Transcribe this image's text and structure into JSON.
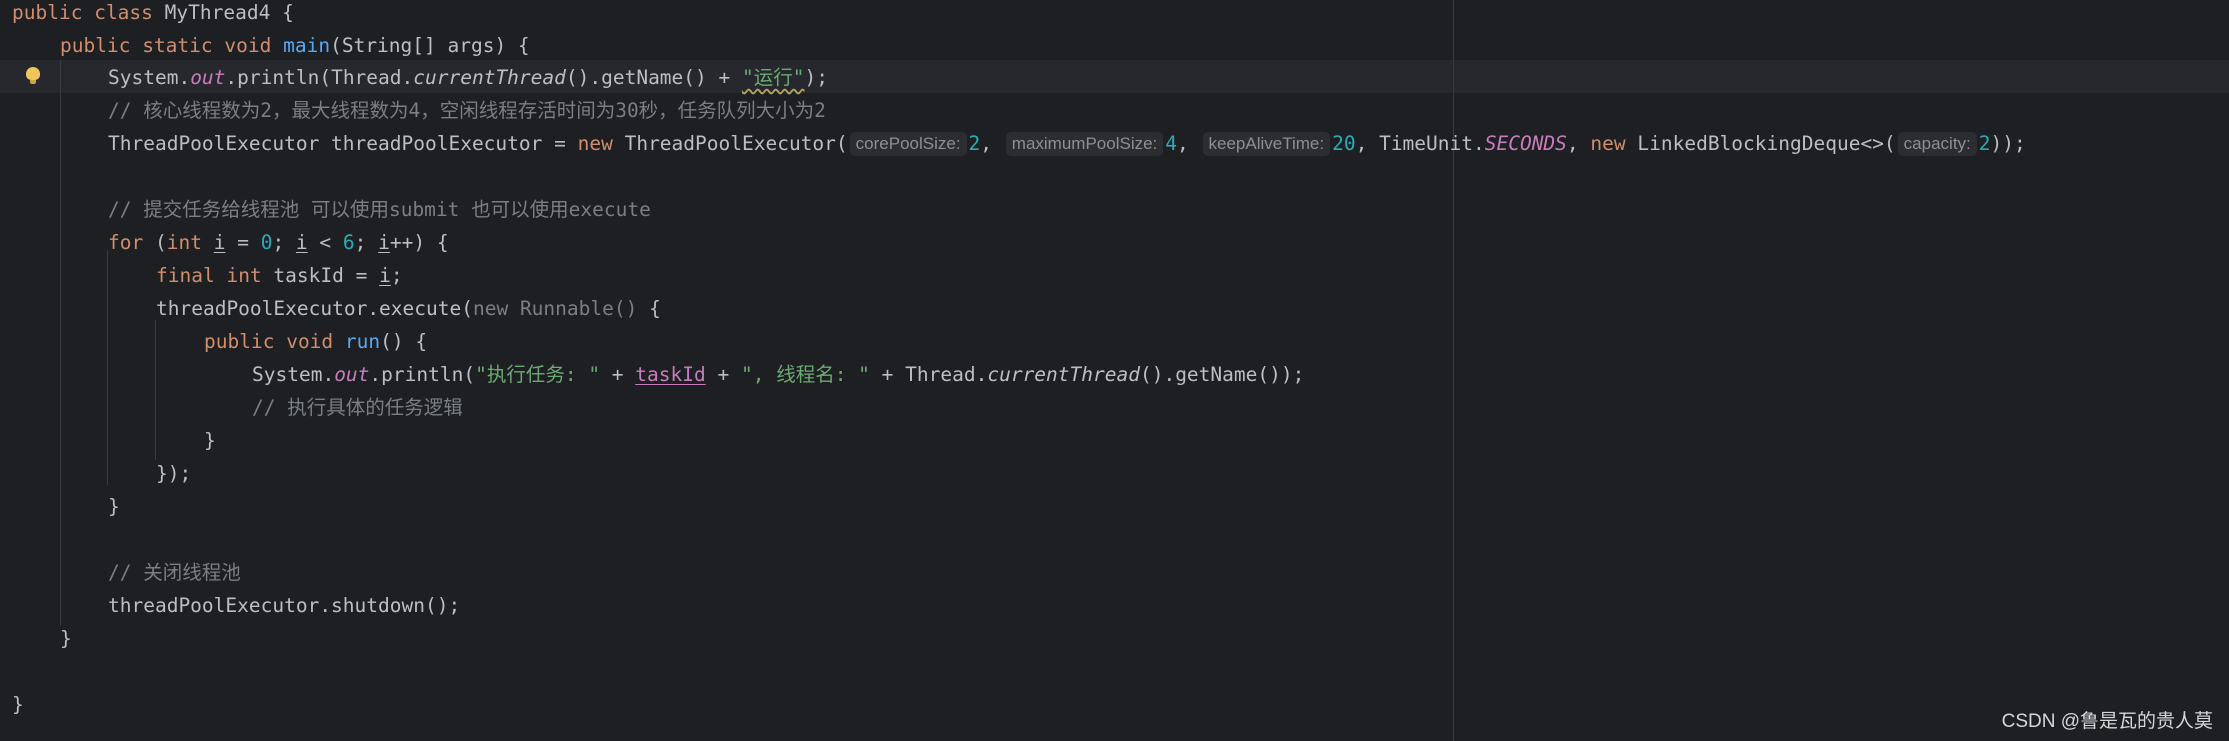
{
  "class_header": {
    "kw_public": "public",
    "kw_class": "class",
    "class_name": "MyThread4",
    "brace": " {"
  },
  "main_header": {
    "kw_public": "public",
    "kw_static": "static",
    "kw_void": "void",
    "method_name": "main",
    "params": "(String[] args) {"
  },
  "line_print_main": {
    "system": "System.",
    "out": "out",
    "println_open": ".println(Thread.",
    "current_thread": "currentThread",
    "get_name": "().getName() + ",
    "string_literal": "\"运行\"",
    "close": ");"
  },
  "comment_pool_config": "// 核心线程数为2，最大线程数为4，空闲线程存活时间为30秒，任务队列大小为2",
  "line_executor_decl": {
    "declaration": "ThreadPoolExecutor threadPoolExecutor = ",
    "kw_new": "new",
    "constructor_open": " ThreadPoolExecutor(",
    "hint_core": "corePoolSize:",
    "val_core": "2",
    "sep1": ", ",
    "hint_max": "maximumPoolSize:",
    "val_max": "4",
    "sep2": ", ",
    "hint_keep_alive": "keepAliveTime:",
    "val_keep_alive": "20",
    "time_unit": ", TimeUnit.",
    "seconds": "SECONDS",
    "sep3": ", ",
    "kw_new2": "new",
    "deque_open": " LinkedBlockingDeque<>(",
    "hint_capacity": "capacity:",
    "val_capacity": "2",
    "close": "));"
  },
  "comment_submit": "// 提交任务给线程池 可以使用submit 也可以使用execute",
  "line_for": {
    "kw_for": "for",
    "open": " (",
    "kw_int": "int",
    "var1": "i",
    "assign": " = ",
    "zero": "0",
    "semi1": "; ",
    "var2": "i",
    "less": " < ",
    "six": "6",
    "semi2": "; ",
    "var3": "i",
    "tail": "++) {"
  },
  "line_task_id": {
    "kw_final": "final",
    "kw_int": "int",
    "mid": " taskId = ",
    "var_i": "i",
    "semi": ";"
  },
  "line_execute": {
    "call": "threadPoolExecutor.execute(",
    "anon": "new Runnable()",
    "brace": " {"
  },
  "line_run": {
    "kw_public": "public",
    "kw_void": "void",
    "method_name": "run",
    "tail": "() {"
  },
  "line_print_task": {
    "system": "System.",
    "out": "out",
    "println_open": ".println(",
    "str1": "\"执行任务: \"",
    "plus1": " + ",
    "task_id": "taskId",
    "plus2": " + ",
    "str2": "\", 线程名: \"",
    "plus3": " + Thread.",
    "current_thread": "currentThread",
    "tail": "().getName());"
  },
  "comment_task_logic": "// 执行具体的任务逻辑",
  "close_run": "}",
  "close_execute": "});",
  "close_for": "}",
  "comment_shutdown": "// 关闭线程池",
  "line_shutdown": "threadPoolExecutor.shutdown();",
  "close_main": "}",
  "close_class": "}",
  "watermark": "CSDN @鲁是瓦的贵人莫"
}
